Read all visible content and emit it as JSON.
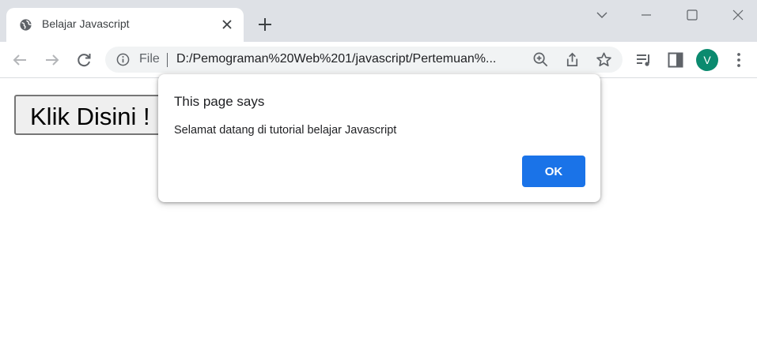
{
  "browser": {
    "tab": {
      "title": "Belajar Javascript",
      "favicon": "globe-icon"
    },
    "new_tab_icon": "plus-icon",
    "window_controls": [
      "chevron-down-icon",
      "minimize-icon",
      "maximize-icon",
      "close-icon"
    ],
    "address_bar": {
      "scheme_label": "File",
      "url": "D:/Pemograman%20Web%201/javascript/Pertemuan%...",
      "info_icon": "info-icon",
      "actions": [
        "zoom-icon",
        "share-icon",
        "bookmark-star-icon"
      ]
    },
    "nav": [
      "back-arrow-icon",
      "forward-arrow-icon",
      "reload-icon"
    ],
    "toolbar_right": [
      "media-queue-icon",
      "side-panel-icon"
    ],
    "profile": {
      "initial": "V",
      "color": "#0b8a6f"
    },
    "menu_icon": "kebab-menu-icon"
  },
  "page": {
    "button_label": "Klik Disini !"
  },
  "dialog": {
    "title": "This page says",
    "message": "Selamat datang di tutorial belajar Javascript",
    "ok_label": "OK",
    "ok_color": "#1a73e8"
  }
}
